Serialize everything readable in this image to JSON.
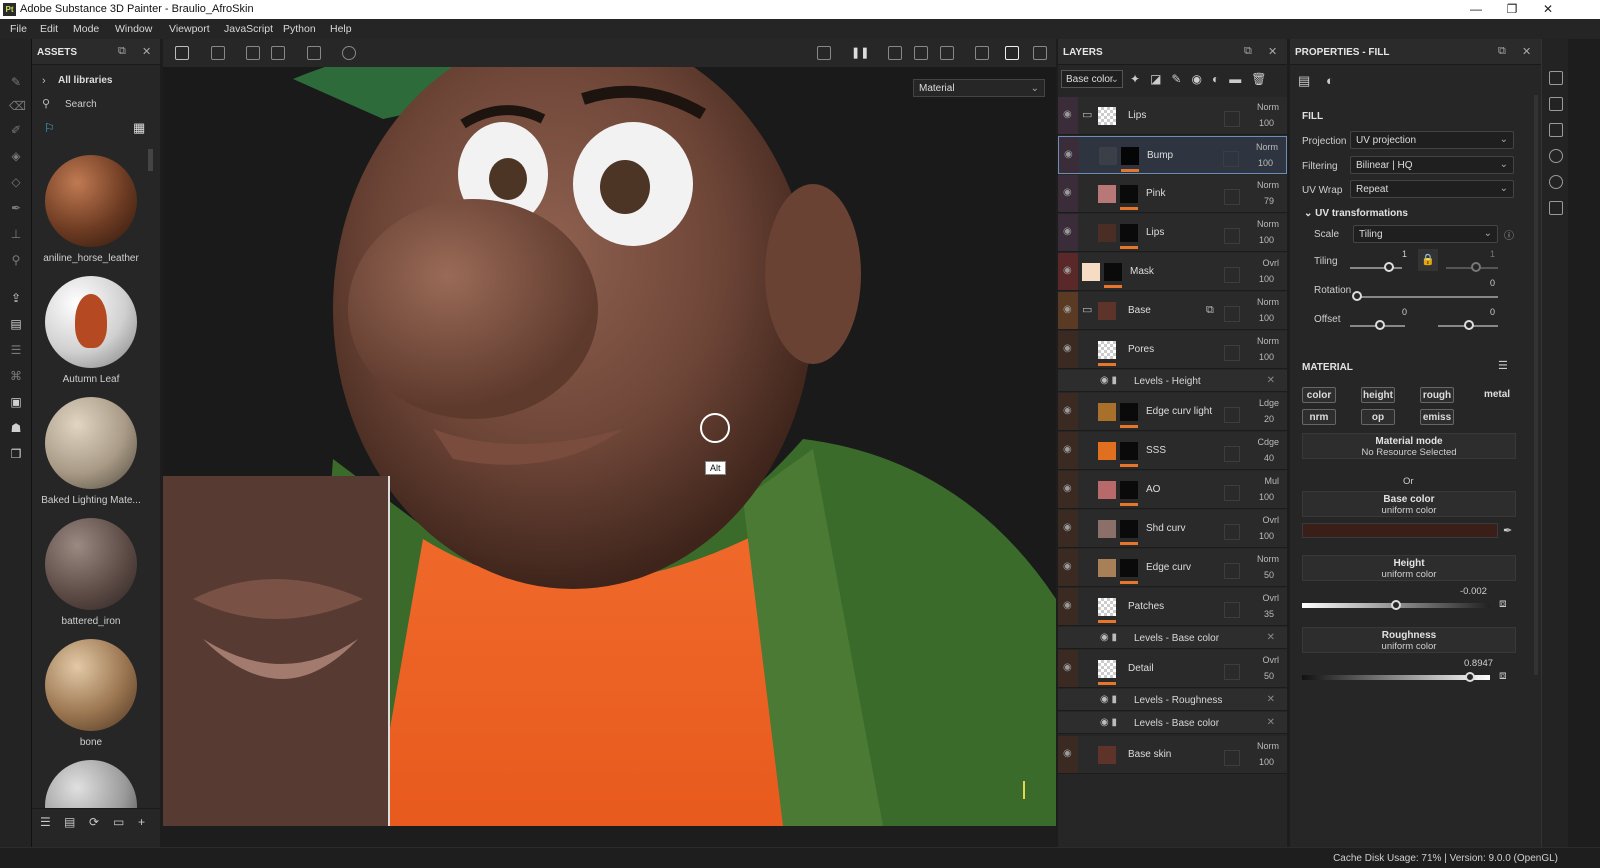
{
  "window": {
    "title": "Adobe Substance 3D Painter - Braulio_AfroSkin",
    "logo": "Pt",
    "controls": [
      "—",
      "❐",
      "✕"
    ]
  },
  "menu": [
    "File",
    "Edit",
    "Mode",
    "Window",
    "Viewport",
    "JavaScript",
    "Python",
    "Help"
  ],
  "assets": {
    "title": "ASSETS",
    "breadcrumb": "All libraries",
    "search_placeholder": "Search",
    "items": [
      {
        "name": "aniline_horse_leather"
      },
      {
        "name": "Autumn Leaf"
      },
      {
        "name": "Baked Lighting Mate..."
      },
      {
        "name": "battered_iron"
      },
      {
        "name": "bone"
      }
    ]
  },
  "viewport": {
    "mode_select": "Material",
    "cursor_hint": "Alt"
  },
  "layers": {
    "title": "LAYERS",
    "channel": "Base color",
    "rows": [
      {
        "name": "Lips",
        "blend": "Norm",
        "opacity": "100",
        "type": "folder"
      },
      {
        "name": "Bump",
        "blend": "Norm",
        "opacity": "100",
        "type": "layer"
      },
      {
        "name": "Pink",
        "blend": "Norm",
        "opacity": "79",
        "type": "layer"
      },
      {
        "name": "Lips",
        "blend": "Norm",
        "opacity": "100",
        "type": "layer"
      },
      {
        "name": "Mask",
        "blend": "Ovrl",
        "opacity": "100",
        "type": "layer"
      },
      {
        "name": "Base",
        "blend": "Norm",
        "opacity": "100",
        "type": "folder"
      },
      {
        "name": "Pores",
        "blend": "Norm",
        "opacity": "100",
        "type": "layer"
      },
      {
        "name": "Levels - Height",
        "type": "fx"
      },
      {
        "name": "Edge curv light",
        "blend": "Ldge",
        "opacity": "20",
        "type": "layer"
      },
      {
        "name": "SSS",
        "blend": "Cdge",
        "opacity": "40",
        "type": "layer"
      },
      {
        "name": "AO",
        "blend": "Mul",
        "opacity": "100",
        "type": "layer"
      },
      {
        "name": "Shd curv",
        "blend": "Ovrl",
        "opacity": "100",
        "type": "layer"
      },
      {
        "name": "Edge curv",
        "blend": "Norm",
        "opacity": "50",
        "type": "layer"
      },
      {
        "name": "Patches",
        "blend": "Ovrl",
        "opacity": "35",
        "type": "layer"
      },
      {
        "name": "Levels - Base color",
        "type": "fx"
      },
      {
        "name": "Detail",
        "blend": "Ovrl",
        "opacity": "50",
        "type": "layer"
      },
      {
        "name": "Levels - Roughness",
        "type": "fx"
      },
      {
        "name": "Levels - Base color",
        "type": "fx"
      },
      {
        "name": "Base skin",
        "blend": "Norm",
        "opacity": "100",
        "type": "layer"
      }
    ]
  },
  "properties": {
    "title": "PROPERTIES - FILL",
    "fill": "FILL",
    "projection_label": "Projection",
    "projection": "UV projection",
    "filtering_label": "Filtering",
    "filtering": "Bilinear | HQ",
    "uvwrap_label": "UV Wrap",
    "uvwrap": "Repeat",
    "uvt": "UV transformations",
    "scale_label": "Scale",
    "scale": "Tiling",
    "tiling_label": "Tiling",
    "tiling_a": "1",
    "tiling_b": "1",
    "rotation_label": "Rotation",
    "rotation": "0",
    "offset_label": "Offset",
    "offset_a": "0",
    "offset_b": "0",
    "material": "MATERIAL",
    "channels": [
      "color",
      "height",
      "rough",
      "metal",
      "nrm",
      "op",
      "emiss"
    ],
    "mode_title": "Material mode",
    "mode_sub": "No Resource Selected",
    "or": "Or",
    "base_color_title": "Base color",
    "base_color_sub": "uniform color",
    "base_color_hex": "#3a1f19",
    "height_title": "Height",
    "height_sub": "uniform color",
    "height_value": "-0.002",
    "height_level": 0.5,
    "rough_title": "Roughness",
    "rough_sub": "uniform color",
    "rough_value": "0.8947",
    "rough_level": 0.8947
  },
  "status": "Cache Disk Usage:    71% | Version: 9.0.0 (OpenGL)"
}
